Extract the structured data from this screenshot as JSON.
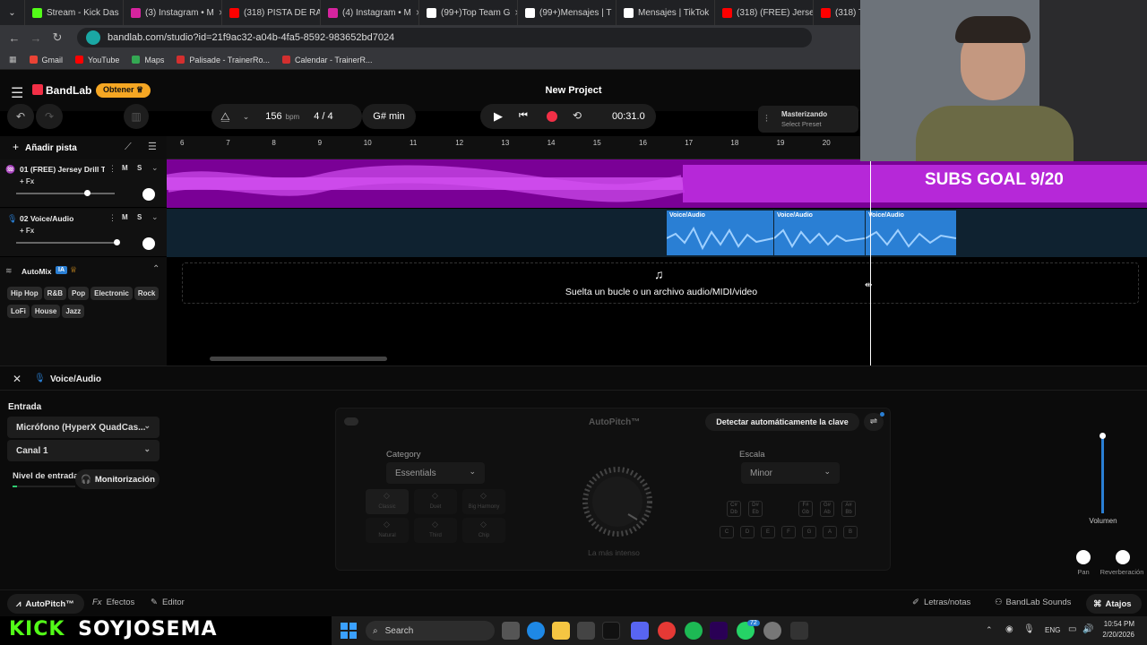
{
  "browser": {
    "tabs": [
      {
        "label": "Stream - Kick Das",
        "color": "#53fc18"
      },
      {
        "label": "(3) Instagram • M",
        "color": "#d6249f"
      },
      {
        "label": "(318) PISTA DE RA",
        "color": "#ff0000"
      },
      {
        "label": "(4) Instagram • M",
        "color": "#d6249f"
      },
      {
        "label": "(99+)Top Team G",
        "color": "#ffffff"
      },
      {
        "label": "(99+)Mensajes | T",
        "color": "#ffffff"
      },
      {
        "label": "Mensajes | TikTok",
        "color": "#ffffff"
      },
      {
        "label": "(318) (FREE) Jersey",
        "color": "#ff0000"
      },
      {
        "label": "(318) T",
        "color": "#ff0000"
      }
    ],
    "url": "bandlab.com/studio?id=21f9ac32-a04b-4fa5-8592-983652bd7024",
    "bookmarks": [
      "Gmail",
      "YouTube",
      "Maps",
      "Palisade - TrainerRo...",
      "Calendar - TrainerR..."
    ]
  },
  "app": {
    "logo": "BandLab",
    "obtain_label": "Obtener",
    "project_title": "New Project",
    "mastering_title": "Masterizando",
    "mastering_sub": "Select Preset",
    "bpm": "156",
    "bpm_unit": "bpm",
    "time_sig": "4 / 4",
    "key": "G# min",
    "time": "00:31.0",
    "add_track": "Añadir pista"
  },
  "ruler": [
    "6",
    "7",
    "8",
    "9",
    "10",
    "11",
    "12",
    "13",
    "14",
    "15",
    "16",
    "17",
    "18",
    "19",
    "20"
  ],
  "tracks": [
    {
      "name": "01  (FREE) Jersey Drill T...",
      "fx": "+ Fx",
      "mute": "M",
      "solo": "S",
      "color": "#b100d6"
    },
    {
      "name": "02  Voice/Audio",
      "fx": "+ Fx",
      "mute": "M",
      "solo": "S",
      "color": "#2a7fd4"
    }
  ],
  "clips": [
    "Voice/Audio",
    "Voice/Audio",
    "Voice/Audio"
  ],
  "overlay_text": "SUBS GOAL 9/20",
  "drop_text": "Suelta un bucle o un archivo audio/MIDI/video",
  "automix": {
    "title": "AutoMix",
    "badge": "IA",
    "genres": [
      "Hip Hop",
      "R&B",
      "Pop",
      "Electronic",
      "Rock",
      "LoFi",
      "House",
      "Jazz"
    ]
  },
  "panel": {
    "title": "Voice/Audio",
    "input_label": "Entrada",
    "mic": "Micrófono (HyperX QuadCas...",
    "channel": "Canal 1",
    "level_label": "Nivel de entrada",
    "monitor": "Monitorización",
    "autopitch": "AutoPitch™",
    "detect": "Detectar automáticamente la clave",
    "category_label": "Category",
    "category": "Essentials",
    "scale_label": "Escala",
    "scale": "Minor",
    "presets": [
      "Classic",
      "Duet",
      "Big Harmony",
      "Natural",
      "Third",
      "Chip"
    ],
    "dial_label": "La más intenso",
    "keys_sharp": [
      "C#\nDb",
      "D#\nEb",
      "F#\nGb",
      "G#\nAb",
      "A#\nBb"
    ],
    "keys_nat": [
      "C",
      "D",
      "E",
      "F",
      "G",
      "A",
      "B"
    ],
    "volume": "Volumen",
    "pan": "Pan",
    "reverb": "Reverberación"
  },
  "footer": {
    "autopitch": "AutoPitch™",
    "effects": "Efectos",
    "editor": "Editor",
    "lyrics": "Letras/notas",
    "sounds": "BandLab Sounds",
    "shortcuts": "Atajos"
  },
  "stream_overlay": {
    "brand": "KICK",
    "handle": "SOYJOSEMA"
  },
  "taskbar": {
    "search": "Search",
    "lang": "ENG",
    "time": "10:54 PM",
    "date": "2/20/2026",
    "badge": "72"
  },
  "colors": {
    "accent": "#f22f46",
    "obtain": "#f5a623",
    "track1": "#b100d6",
    "track2": "#2a7fd4",
    "kick": "#53fc18"
  }
}
